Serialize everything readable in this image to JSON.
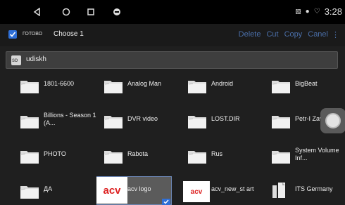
{
  "statusbar": {
    "time": "3:28"
  },
  "toolbar": {
    "select_tag": "ГОТОВО",
    "choose": "Choose 1",
    "actions": [
      "Delete",
      "Cut",
      "Copy",
      "Canel"
    ]
  },
  "path": {
    "sd_label": "SD",
    "text": "udiskh"
  },
  "items": [
    {
      "label": "1801-6600",
      "type": "folder"
    },
    {
      "label": "Analog Man",
      "type": "folder"
    },
    {
      "label": "Android",
      "type": "folder"
    },
    {
      "label": "BigBeat",
      "type": "folder"
    },
    {
      "label": "Billions - Season 1 (A...",
      "type": "folder"
    },
    {
      "label": "DVR video",
      "type": "folder"
    },
    {
      "label": "LOST.DIR",
      "type": "folder"
    },
    {
      "label": "Petr-I Zave",
      "type": "folder"
    },
    {
      "label": "PHOTO",
      "type": "folder"
    },
    {
      "label": "Rabota",
      "type": "folder"
    },
    {
      "label": "Rus",
      "type": "folder"
    },
    {
      "label": "System Volume Inf...",
      "type": "folder"
    },
    {
      "label": "ДА",
      "type": "folder"
    },
    {
      "label": "acv logo",
      "type": "image",
      "thumb_text": "acv"
    },
    {
      "label": "acv_new_st art",
      "type": "image",
      "thumb_text": "acv"
    },
    {
      "label": "ITS Germany",
      "type": "file"
    }
  ],
  "colors": {
    "accent": "#2f6fd6",
    "toolbar_action": "#4a6ea8"
  }
}
